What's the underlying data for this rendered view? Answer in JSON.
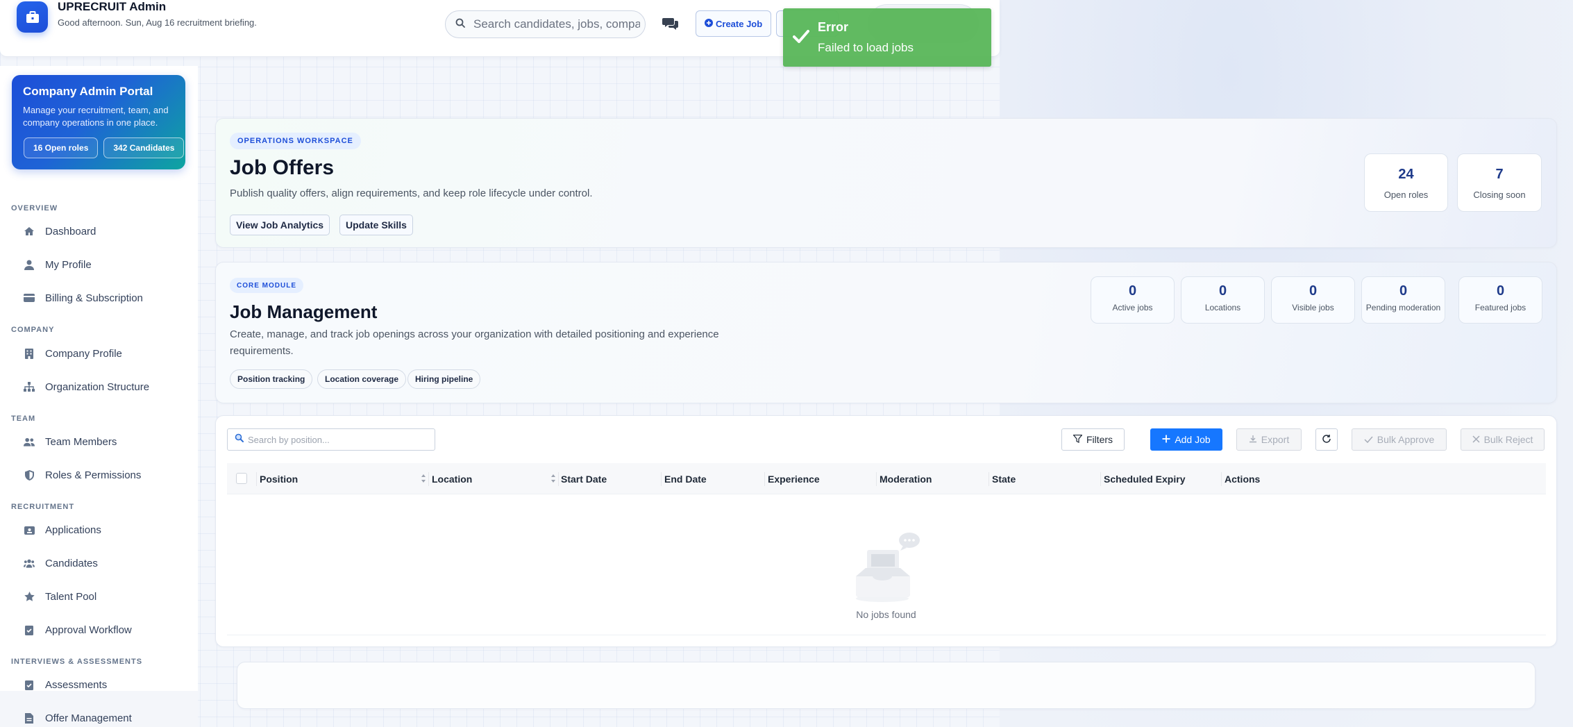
{
  "header": {
    "app_title": "UPRECRUIT Admin",
    "greeting": "Good afternoon. Sun, Aug 16 recruitment briefing.",
    "search_placeholder": "Search candidates, jobs, companies",
    "create_job_label": "Create Job"
  },
  "toast": {
    "title": "Error",
    "message": "Failed to load jobs",
    "color": "#5cb85c"
  },
  "sidebar": {
    "portal": {
      "title": "Company Admin Portal",
      "description": "Manage your recruitment, team, and company operations in one place.",
      "badge_open_roles": "16 Open roles",
      "badge_candidates": "342 Candidates"
    },
    "sections": {
      "overview": "OVERVIEW",
      "company": "COMPANY",
      "team": "TEAM",
      "recruitment": "RECRUITMENT",
      "interviews": "INTERVIEWS & ASSESSMENTS"
    },
    "items": {
      "dashboard": "Dashboard",
      "my_profile": "My Profile",
      "billing": "Billing & Subscription",
      "company_profile": "Company Profile",
      "org_structure": "Organization Structure",
      "team_members": "Team Members",
      "roles_permissions": "Roles & Permissions",
      "applications": "Applications",
      "candidates": "Candidates",
      "talent_pool": "Talent Pool",
      "approval_workflow": "Approval Workflow",
      "assessments": "Assessments",
      "offer_management": "Offer Management"
    }
  },
  "offers": {
    "tag": "OPERATIONS WORKSPACE",
    "title": "Job Offers",
    "description": "Publish quality offers, align requirements, and keep role lifecycle under control.",
    "btn_analytics": "View Job Analytics",
    "btn_skills": "Update Skills",
    "stats": [
      {
        "value": "24",
        "label": "Open roles"
      },
      {
        "value": "7",
        "label": "Closing soon"
      }
    ]
  },
  "management": {
    "tag": "CORE MODULE",
    "title": "Job Management",
    "description": "Create, manage, and track job openings across your organization with detailed positioning and experience requirements.",
    "chips": [
      "Position tracking",
      "Location coverage",
      "Hiring pipeline"
    ],
    "stats": [
      {
        "value": "0",
        "label": "Active jobs"
      },
      {
        "value": "0",
        "label": "Locations"
      },
      {
        "value": "0",
        "label": "Visible jobs"
      },
      {
        "value": "0",
        "label": "Pending moderation"
      },
      {
        "value": "0",
        "label": "Featured jobs"
      }
    ]
  },
  "table": {
    "search_placeholder": "Search by position...",
    "filters_label": "Filters",
    "add_job_label": "Add Job",
    "export_label": "Export",
    "bulk_approve_label": "Bulk Approve",
    "bulk_reject_label": "Bulk Reject",
    "columns": [
      "Position",
      "Location",
      "Start Date",
      "End Date",
      "Experience",
      "Moderation",
      "State",
      "Scheduled Expiry",
      "Actions"
    ],
    "empty_text": "No jobs found"
  },
  "colors": {
    "primary": "#1677ff",
    "brand": "#1d4ed8",
    "portal_gradient_end": "#0ea5a0"
  }
}
